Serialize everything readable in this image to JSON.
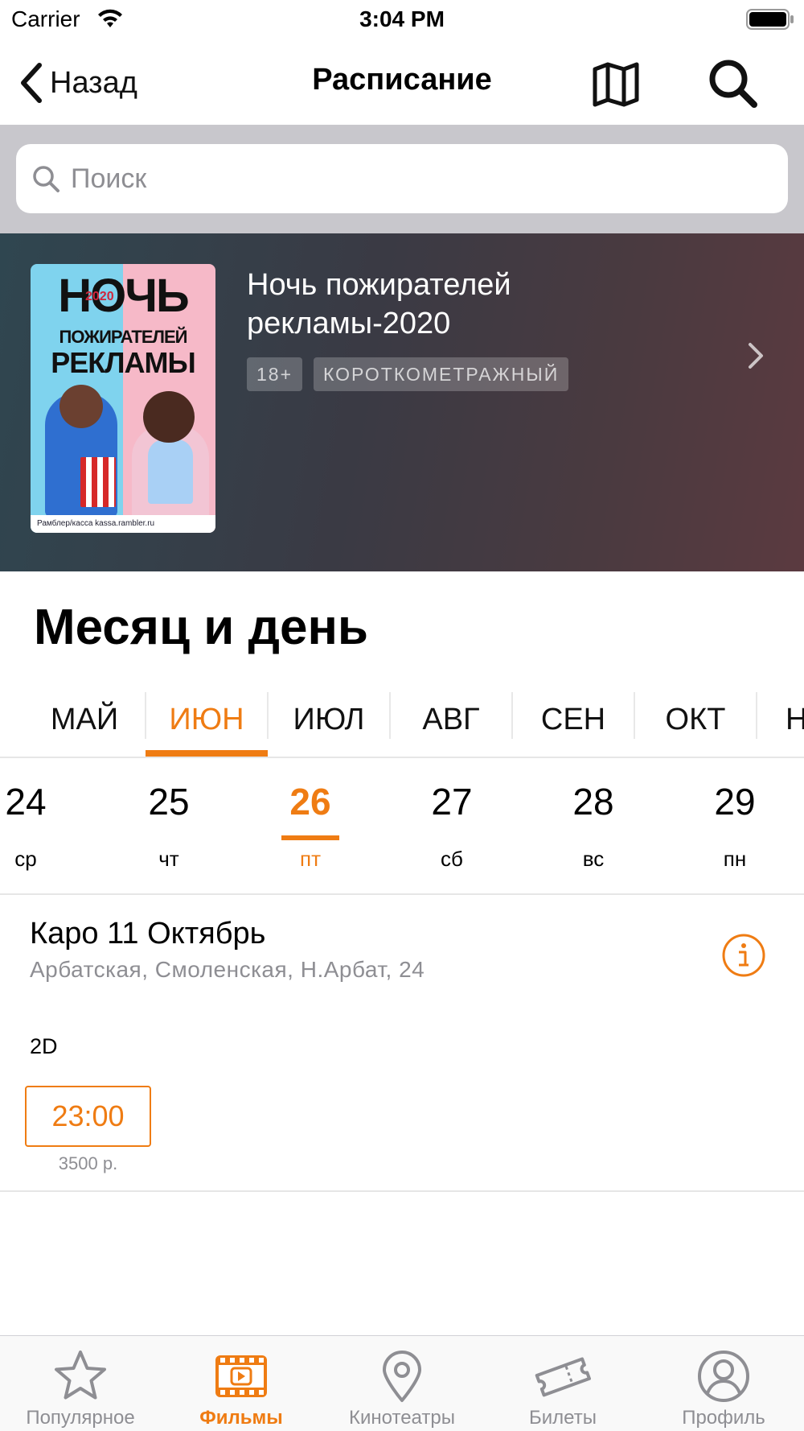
{
  "status_bar": {
    "carrier": "Carrier",
    "time": "3:04 PM"
  },
  "nav": {
    "back_label": "Назад",
    "title": "Расписание"
  },
  "search": {
    "placeholder": "Поиск"
  },
  "movie": {
    "title": "Ночь пожирателей рекламы-2020",
    "age_rating": "18+",
    "genre": "КОРОТКОМЕТРАЖНЫЙ",
    "poster": {
      "title_line1": "НОЧЬ",
      "year": "2020",
      "title_line2": "ПОЖИРАТЕЛЕЙ",
      "title_line3": "РЕКЛАМЫ",
      "footer": "Рамблер/касса   kassa.rambler.ru"
    }
  },
  "section_title": "Месяц и день",
  "months": [
    {
      "label": "МАЙ",
      "selected": false
    },
    {
      "label": "ИЮН",
      "selected": true
    },
    {
      "label": "ИЮЛ",
      "selected": false
    },
    {
      "label": "АВГ",
      "selected": false
    },
    {
      "label": "СЕН",
      "selected": false
    },
    {
      "label": "ОКТ",
      "selected": false
    },
    {
      "label": "Н",
      "selected": false
    }
  ],
  "days": [
    {
      "num": "24",
      "weekday": "ср",
      "selected": false
    },
    {
      "num": "25",
      "weekday": "чт",
      "selected": false
    },
    {
      "num": "26",
      "weekday": "пт",
      "selected": true
    },
    {
      "num": "27",
      "weekday": "сб",
      "selected": false
    },
    {
      "num": "28",
      "weekday": "вс",
      "selected": false
    },
    {
      "num": "29",
      "weekday": "пн",
      "selected": false
    }
  ],
  "cinema": {
    "name": "Каро 11 Октябрь",
    "address": "Арбатская, Смоленская, Н.Арбат, 24",
    "format": "2D",
    "sessions": [
      {
        "time": "23:00",
        "price": "3500 р."
      }
    ]
  },
  "tabs": [
    {
      "label": "Популярное",
      "icon": "star-icon",
      "active": false
    },
    {
      "label": "Фильмы",
      "icon": "film-icon",
      "active": true
    },
    {
      "label": "Кинотеатры",
      "icon": "location-pin-icon",
      "active": false
    },
    {
      "label": "Билеты",
      "icon": "ticket-icon",
      "active": false
    },
    {
      "label": "Профиль",
      "icon": "profile-icon",
      "active": false
    }
  ],
  "colors": {
    "accent": "#ef7c13",
    "secondary_text": "#8e8e93",
    "search_bg": "#c8c7cc"
  }
}
